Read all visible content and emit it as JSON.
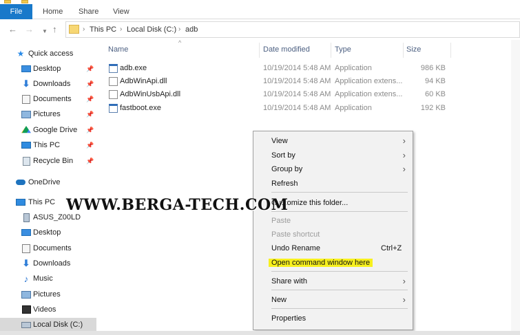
{
  "ribbon": {
    "tabs": [
      "File",
      "Home",
      "Share",
      "View"
    ],
    "file_color": "#1979ca"
  },
  "address": {
    "breadcrumbs": [
      "This PC",
      "Local Disk (C:)",
      "adb"
    ]
  },
  "nav": {
    "quick_access": "Quick access",
    "quick_items": [
      {
        "label": "Desktop",
        "icon": "desktop-icon"
      },
      {
        "label": "Downloads",
        "icon": "downloads-icon"
      },
      {
        "label": "Documents",
        "icon": "documents-icon"
      },
      {
        "label": "Pictures",
        "icon": "pictures-icon"
      },
      {
        "label": "Google Drive",
        "icon": "google-drive-icon"
      },
      {
        "label": "This PC",
        "icon": "this-pc-icon"
      },
      {
        "label": "Recycle Bin",
        "icon": "recycle-bin-icon"
      }
    ],
    "onedrive": "OneDrive",
    "this_pc": "This PC",
    "pc_items": [
      {
        "label": "ASUS_Z00LD",
        "icon": "device-icon"
      },
      {
        "label": "Desktop",
        "icon": "desktop-icon"
      },
      {
        "label": "Documents",
        "icon": "documents-icon"
      },
      {
        "label": "Downloads",
        "icon": "downloads-icon"
      },
      {
        "label": "Music",
        "icon": "music-icon"
      },
      {
        "label": "Pictures",
        "icon": "pictures-icon"
      },
      {
        "label": "Videos",
        "icon": "videos-icon"
      },
      {
        "label": "Local Disk (C:)",
        "icon": "drive-icon"
      }
    ]
  },
  "columns": {
    "name": "Name",
    "date": "Date modified",
    "type": "Type",
    "size": "Size"
  },
  "files": [
    {
      "name": "adb.exe",
      "date": "10/19/2014 5:48 AM",
      "type": "Application",
      "size": "986 KB",
      "icon": "exe-icon"
    },
    {
      "name": "AdbWinApi.dll",
      "date": "10/19/2014 5:48 AM",
      "type": "Application extens...",
      "size": "94 KB",
      "icon": "dll-icon"
    },
    {
      "name": "AdbWinUsbApi.dll",
      "date": "10/19/2014 5:48 AM",
      "type": "Application extens...",
      "size": "60 KB",
      "icon": "dll-icon"
    },
    {
      "name": "fastboot.exe",
      "date": "10/19/2014 5:48 AM",
      "type": "Application",
      "size": "192 KB",
      "icon": "exe-icon"
    }
  ],
  "watermark": "WWW.BERGA-TECH.COM",
  "context_menu": {
    "view": "View",
    "sort_by": "Sort by",
    "group_by": "Group by",
    "refresh": "Refresh",
    "customize": "Customize this folder...",
    "paste": "Paste",
    "paste_shortcut": "Paste shortcut",
    "undo_rename": "Undo Rename",
    "undo_shortcut": "Ctrl+Z",
    "open_cmd": "Open command window here",
    "share_with": "Share with",
    "new": "New",
    "properties": "Properties",
    "highlight_color": "#f7f01e"
  }
}
